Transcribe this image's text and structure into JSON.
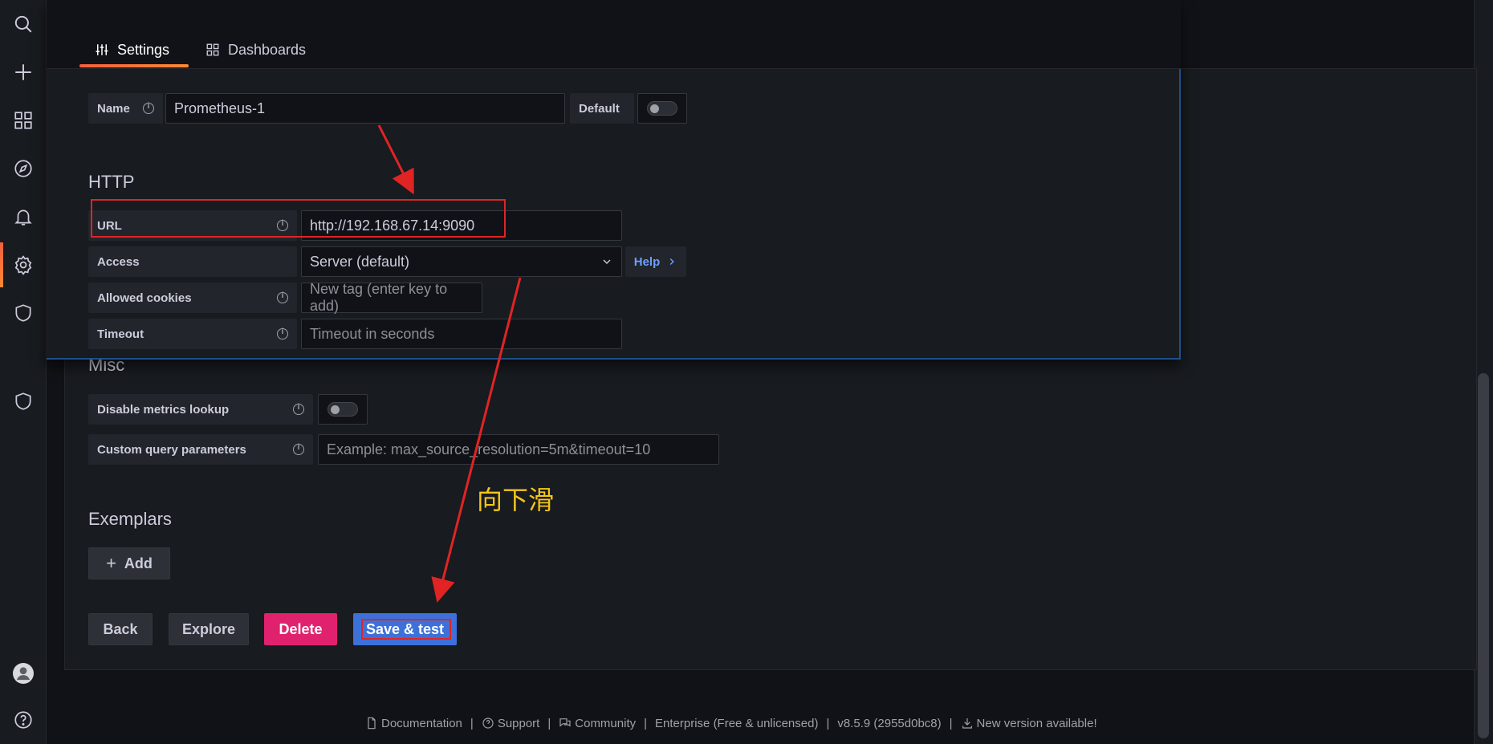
{
  "tabs": [
    {
      "label": "Settings",
      "icon": "sliders-icon",
      "active": true
    },
    {
      "label": "Dashboards",
      "icon": "apps-icon",
      "active": false
    }
  ],
  "name_field": {
    "label": "Name",
    "value": "Prometheus-1",
    "default_label": "Default",
    "default_on": false
  },
  "http": {
    "title": "HTTP",
    "url": {
      "label": "URL",
      "value": "http://192.168.67.14:9090"
    },
    "access": {
      "label": "Access",
      "value": "Server (default)",
      "help_label": "Help"
    },
    "allowed_cookies": {
      "label": "Allowed cookies",
      "placeholder": "New tag (enter key to add)"
    },
    "timeout": {
      "label": "Timeout",
      "placeholder": "Timeout in seconds"
    }
  },
  "misc": {
    "title": "Misc",
    "disable_metrics_lookup": {
      "label": "Disable metrics lookup",
      "on": false
    },
    "custom_query": {
      "label": "Custom query parameters",
      "placeholder": "Example: max_source_resolution=5m&timeout=10"
    }
  },
  "exemplars": {
    "title": "Exemplars",
    "add_label": "Add"
  },
  "actions": {
    "back": "Back",
    "explore": "Explore",
    "delete": "Delete",
    "save": "Save & test"
  },
  "annotation": {
    "text": "向下滑",
    "color": "#f5c518",
    "marker_color": "#e02424"
  },
  "footer": {
    "documentation": "Documentation",
    "support": "Support",
    "community": "Community",
    "edition": "Enterprise (Free & unlicensed)",
    "version": "v8.5.9 (2955d0bc8)",
    "new_version": "New version available!",
    "separator": "|"
  },
  "sidebar_icons": [
    "search-icon",
    "plus-icon",
    "dashboards-icon",
    "explore-icon",
    "alerting-icon",
    "configuration-icon",
    "shield-icon",
    "user-avatar",
    "help-icon"
  ],
  "colors": {
    "accent": "#f55f3e",
    "primary": "#3d71d9",
    "danger": "#e0226e",
    "link": "#6e9fff"
  }
}
